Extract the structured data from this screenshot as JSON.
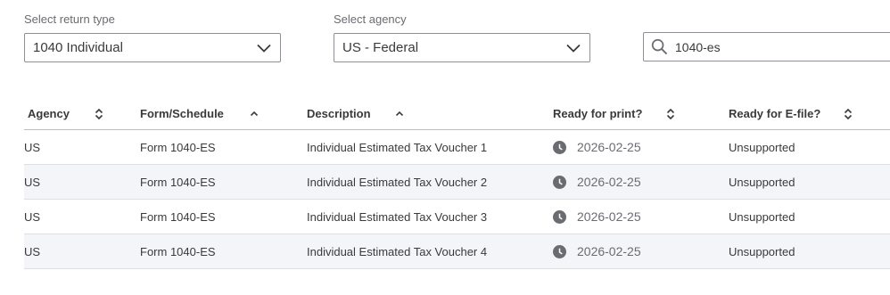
{
  "filters": {
    "return_type": {
      "label": "Select return type",
      "value": "1040 Individual"
    },
    "agency": {
      "label": "Select agency",
      "value": "US - Federal"
    },
    "search": {
      "value": "1040-es"
    }
  },
  "table": {
    "columns": [
      {
        "label": "Agency",
        "sort": "both"
      },
      {
        "label": "Form/Schedule",
        "sort": "asc"
      },
      {
        "label": "Description",
        "sort": "asc"
      },
      {
        "label": "Ready for print?",
        "sort": "both"
      },
      {
        "label": "Ready for E-file?",
        "sort": "both"
      }
    ],
    "rows": [
      {
        "agency": "US",
        "form": "Form 1040-ES",
        "description": "Individual Estimated Tax Voucher 1",
        "print_date": "2026-02-25",
        "efile": "Unsupported"
      },
      {
        "agency": "US",
        "form": "Form 1040-ES",
        "description": "Individual Estimated Tax Voucher 2",
        "print_date": "2026-02-25",
        "efile": "Unsupported"
      },
      {
        "agency": "US",
        "form": "Form 1040-ES",
        "description": "Individual Estimated Tax Voucher 3",
        "print_date": "2026-02-25",
        "efile": "Unsupported"
      },
      {
        "agency": "US",
        "form": "Form 1040-ES",
        "description": "Individual Estimated Tax Voucher 4",
        "print_date": "2026-02-25",
        "efile": "Unsupported"
      }
    ]
  },
  "colors": {
    "text": "#393a3d",
    "muted": "#6b6c72",
    "border": "#8d9096",
    "row_alt": "#f4f5f8"
  },
  "icons": {
    "dropdown": "chevron-down-icon",
    "search": "search-icon",
    "sort": "sort-icon",
    "print_status": "clock-icon"
  }
}
